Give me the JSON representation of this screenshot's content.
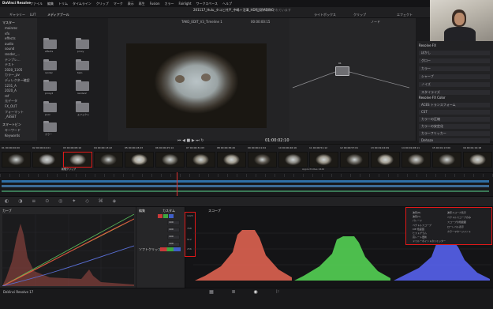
{
  "app": {
    "logo": "DaVinci Resolve",
    "menu": [
      "ファイル",
      "編集",
      "トリム",
      "タイムライン",
      "クリップ",
      "マーク",
      "表示",
      "再生",
      "Fusion",
      "カラー",
      "Fairlight",
      "ワークスペース",
      "ヘルプ"
    ],
    "project_title": "201117_Hulu_タコと井戸_中嶋＋沼澤_HDR_GRADING",
    "project_subtitle": "変更が保存されています",
    "version_label": "DaVinci Resolve 17"
  },
  "toolbar": {
    "gallery": "ギャラリー",
    "lut": "LUT",
    "media_pool": "メディアプール",
    "timeline_name": "TAKO_EDIT_V3_Timeline 1",
    "timecode_top": "00:00:00:15",
    "lightbox": "ライトボックス",
    "clip_label": "クリップ",
    "node_label": "ノード",
    "effects_label": "エフェクト"
  },
  "media": {
    "section_master": "マスター",
    "tree": [
      "mainrec",
      "vfx",
      "effects",
      "audio",
      "sound",
      "render_...",
      "テンプレ...",
      "テスト",
      "2020_1105",
      "カラー_pv",
      "ディレクター確認",
      "1231_A",
      "2020_A",
      "ref",
      "元データ",
      "FX_OUT",
      "フォーマット",
      "_ASSET"
    ],
    "section_smart": "スマートビン",
    "smart_items": [
      "キーワード",
      "Keywords"
    ],
    "folders": [
      "effects",
      "proxy",
      "render",
      "tako",
      "proxy2",
      "render2",
      "pool",
      "エフェクト",
      "カラー"
    ]
  },
  "viewer": {
    "timecode": "01:00:02:10",
    "node_name": "01"
  },
  "clips": [
    {
      "num": "01",
      "tc": "00:00:00:00"
    },
    {
      "num": "02",
      "tc": "00:00:04:01"
    },
    {
      "num": "03",
      "tc": "00:00:08:10"
    },
    {
      "num": "04",
      "tc": "00:00:13:22"
    },
    {
      "num": "05",
      "tc": "00:00:18:23"
    },
    {
      "num": "06",
      "tc": "00:00:25:14"
    },
    {
      "num": "07",
      "tc": "00:00:31:03"
    },
    {
      "num": "08",
      "tc": "00:00:36:20"
    },
    {
      "num": "09",
      "tc": "00:00:41:04"
    },
    {
      "num": "10",
      "tc": "00:00:46:16"
    },
    {
      "num": "11",
      "tc": "00:00:51:12"
    },
    {
      "num": "12",
      "tc": "00:00:57:01"
    },
    {
      "num": "13",
      "tc": "00:01:02:09"
    },
    {
      "num": "14",
      "tc": "00:01:08:11"
    },
    {
      "num": "15",
      "tc": "00:01:13:00"
    },
    {
      "num": "16",
      "tc": "00:01:19:18"
    }
  ],
  "clip_tag": "新規クリップ",
  "clip_tag_right": "Apple ProRes 4444",
  "library": {
    "title_top": "Resolve FX",
    "top_items": [
      "ぼかし",
      "グロー",
      "カラー",
      "シャープ",
      "ノイズ",
      "スタイライズ"
    ],
    "title_mid": "Resolve FX Color",
    "mid_items": [
      "ACES トランスフォーム",
      "CST",
      "カラーの圧縮",
      "カラーの安定化",
      "カラーフリッカー",
      "Dehaze"
    ]
  },
  "bottom": {
    "curves_title": "カーブ",
    "edit_title": "編集",
    "custom_title": "カスタム",
    "scope_title": "スコープ",
    "grade_title": "グレード",
    "soft_clip": "ソフトクリップ",
    "values": [
      "100",
      "100",
      "100",
      "100"
    ],
    "curve_vals": [
      "0",
      "100"
    ],
    "scope_scale": [
      "1023",
      "896",
      "768",
      "640",
      "512",
      "384",
      "256",
      "128",
      "0"
    ],
    "popup": [
      "波形(R)",
      "波形(Y)",
      "パレード",
      "ベクトルスコープ",
      "CIE 色度図",
      "ヒストグラム",
      "高レート更新",
      "ドゥルーポイントのリミッター"
    ],
    "popup_right": [
      "波形スコープ表示",
      "ベクトルスコープのみ",
      "スコープの色範囲",
      "ローレベル表示",
      "カラーマネージメント"
    ]
  },
  "page_tabs": [
    "メディア",
    "カット",
    "エディット",
    "Fusion",
    "カラー",
    "Fairlight",
    "デリバー"
  ],
  "colors": {
    "accent_red": "#e01818",
    "curve_red": "#d84a3c",
    "scope_red": "#e36452",
    "scope_green": "#55d655",
    "scope_blue": "#5560e8"
  }
}
